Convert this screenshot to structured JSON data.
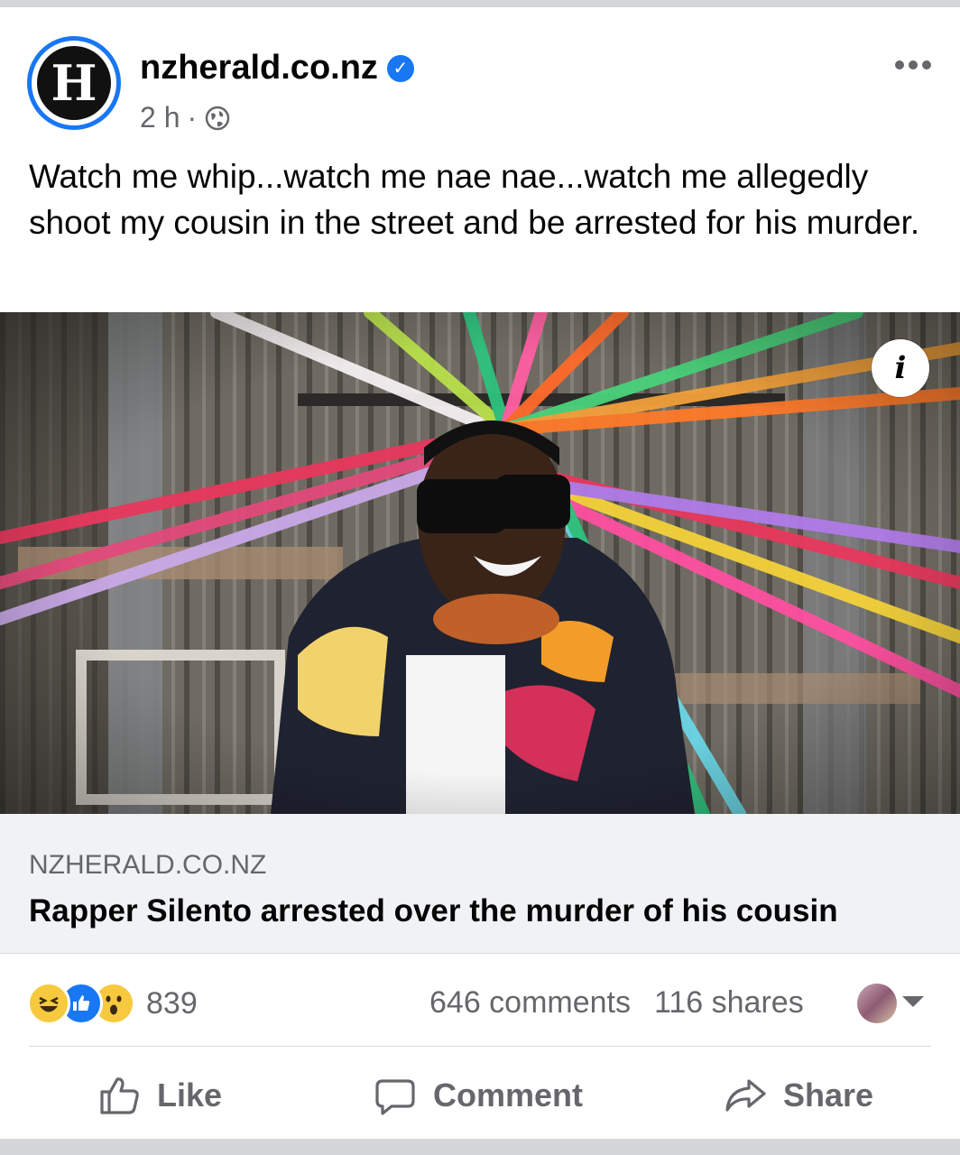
{
  "post": {
    "page_name": "nzherald.co.nz",
    "avatar_letter": "H",
    "time": "2 h",
    "separator": "·",
    "text": "Watch me whip...watch me nae nae...watch me allegedly shoot my cousin in the street and be arrested for his murder.",
    "info_label": "i"
  },
  "link": {
    "domain": "NZHERALD.CO.NZ",
    "title": "Rapper Silento arrested over the murder of his cousin"
  },
  "engagement": {
    "reaction_icons": [
      "haha-icon",
      "like-icon",
      "wow-icon"
    ],
    "reaction_count": "839",
    "comments": "646 comments",
    "shares": "116 shares"
  },
  "actions": {
    "like": "Like",
    "comment": "Comment",
    "share": "Share"
  },
  "colors": {
    "brand": "#1877f2",
    "muted_text": "#65676b",
    "text": "#050505",
    "preview_bg": "#f0f2f5"
  }
}
